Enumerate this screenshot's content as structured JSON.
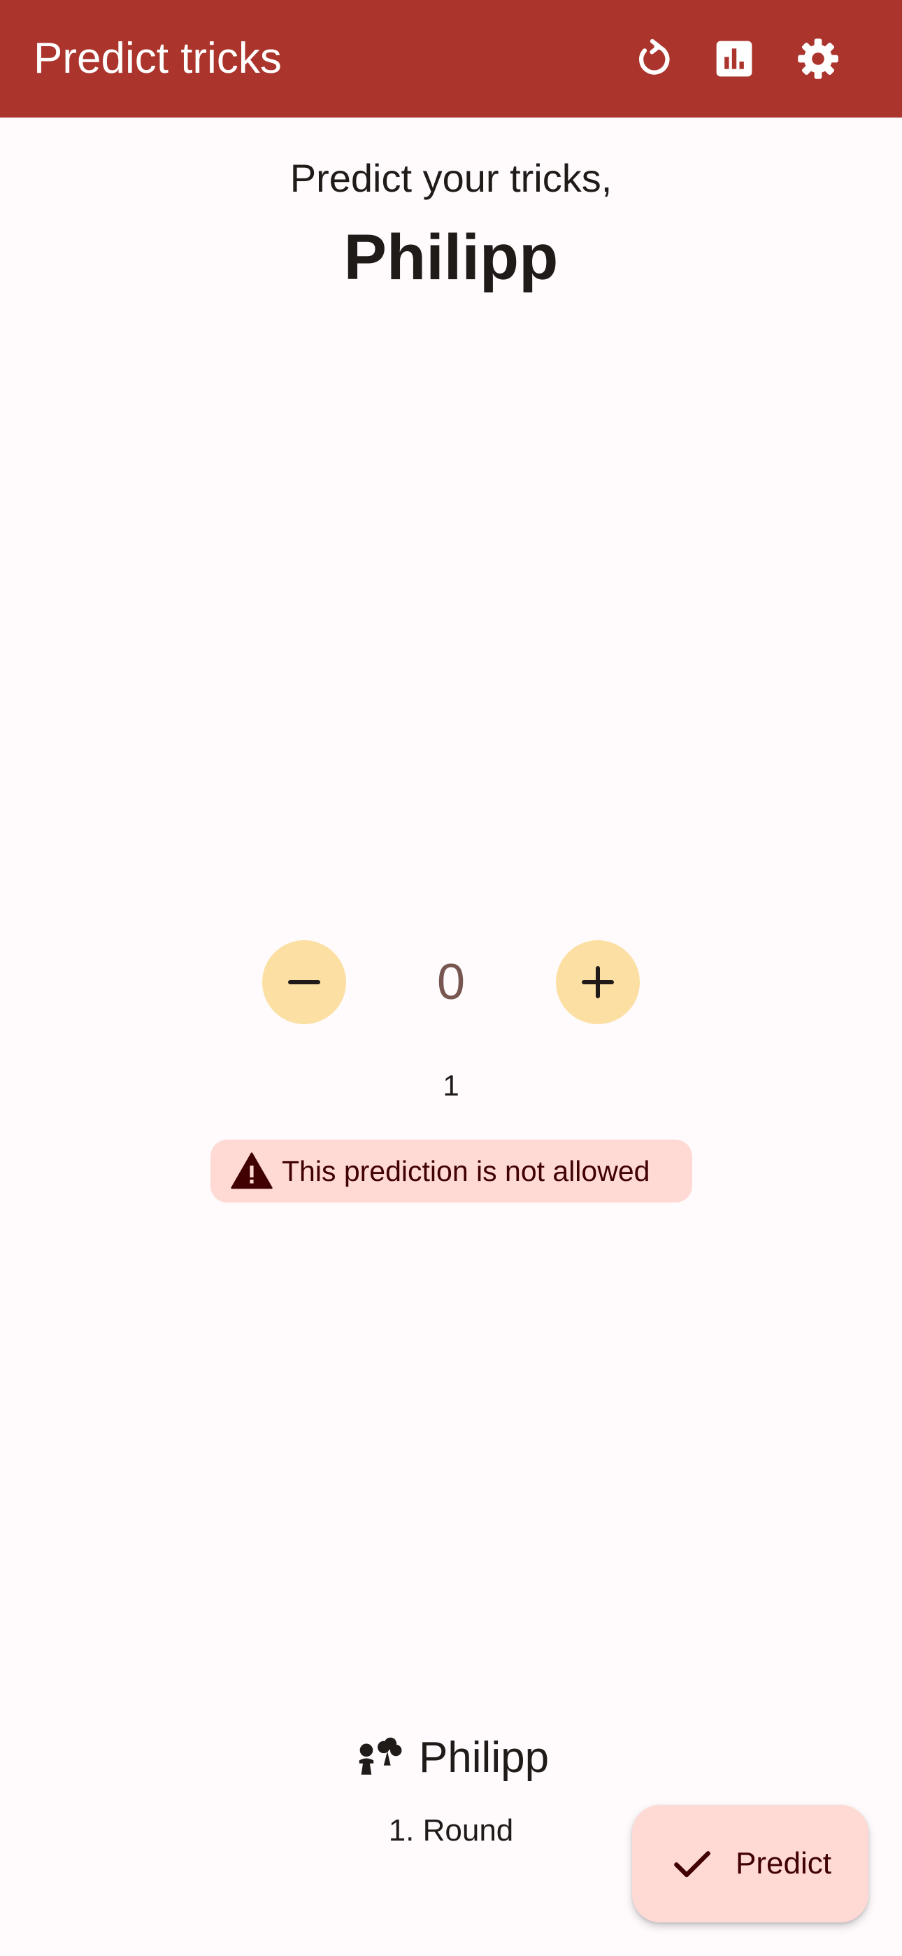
{
  "app_bar": {
    "title": "Predict tricks",
    "actions": [
      {
        "name": "reset",
        "icon": "refresh-icon"
      },
      {
        "name": "statistics",
        "icon": "bar-chart-icon"
      },
      {
        "name": "settings",
        "icon": "gear-icon"
      }
    ],
    "background_color": "#ab352d"
  },
  "prompt": {
    "subtitle": "Predict your tricks,",
    "player_name": "Philipp"
  },
  "prediction": {
    "value": "0",
    "decrement_icon": "minus-icon",
    "increment_icon": "plus-icon",
    "hint_number": "1",
    "warning_text": "This prediction is not allowed",
    "warning_icon": "warning-icon"
  },
  "footer": {
    "dealer_icon": "cards-suit-icon",
    "player_name": "Philipp",
    "round_label": "1. Round"
  },
  "fab": {
    "label": "Predict",
    "icon": "check-icon"
  },
  "colors": {
    "accent": "#ab352d",
    "button_fill": "#fce0a3",
    "warning_bg": "#ffdad5",
    "warning_text": "#410002",
    "counter_text": "#775650"
  }
}
